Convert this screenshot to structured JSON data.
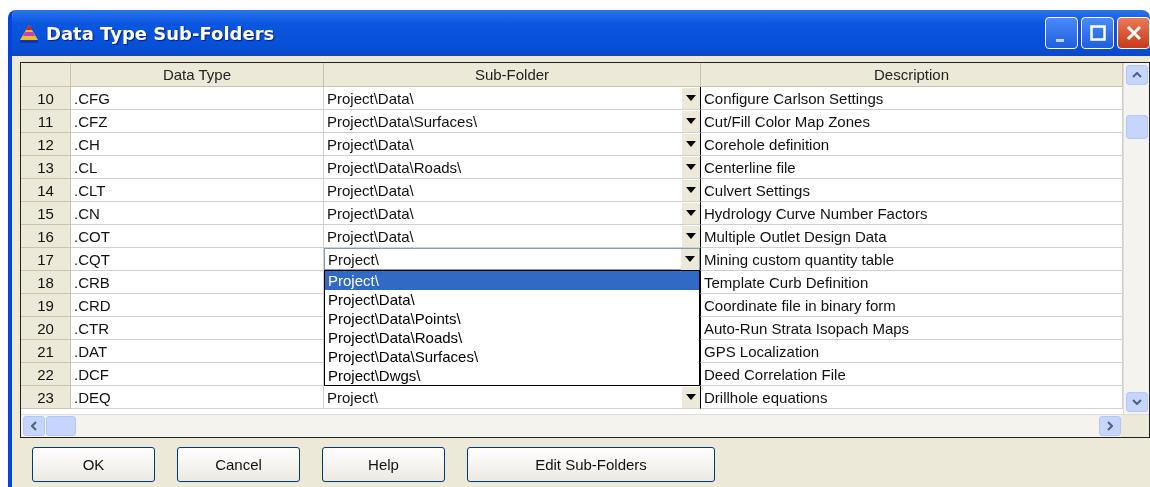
{
  "window": {
    "title": "Data Type Sub-Folders"
  },
  "table": {
    "columns": [
      "Data Type",
      "Sub-Folder",
      "Description"
    ],
    "rows": [
      {
        "number": "10",
        "data_type": ".CFG",
        "sub_folder": "Project\\Data\\",
        "description": "Configure Carlson Settings"
      },
      {
        "number": "11",
        "data_type": ".CFZ",
        "sub_folder": "Project\\Data\\Surfaces\\",
        "description": "Cut/Fill Color Map Zones"
      },
      {
        "number": "12",
        "data_type": ".CH",
        "sub_folder": "Project\\Data\\",
        "description": "Corehole definition"
      },
      {
        "number": "13",
        "data_type": ".CL",
        "sub_folder": "Project\\Data\\Roads\\",
        "description": "Centerline file"
      },
      {
        "number": "14",
        "data_type": ".CLT",
        "sub_folder": "Project\\Data\\",
        "description": "Culvert Settings"
      },
      {
        "number": "15",
        "data_type": ".CN",
        "sub_folder": "Project\\Data\\",
        "description": "Hydrology Curve Number Factors"
      },
      {
        "number": "16",
        "data_type": ".COT",
        "sub_folder": "Project\\Data\\",
        "description": "Multiple Outlet Design Data"
      },
      {
        "number": "17",
        "data_type": ".CQT",
        "sub_folder": "Project\\",
        "description": "Mining custom quantity table",
        "options": [
          {
            "label": "Project\\",
            "selected": true
          },
          {
            "label": "Project\\Data\\",
            "selected": false
          },
          {
            "label": "Project\\Data\\Points\\",
            "selected": false
          },
          {
            "label": "Project\\Data\\Roads\\",
            "selected": false
          },
          {
            "label": "Project\\Data\\Surfaces\\",
            "selected": false
          },
          {
            "label": "Project\\Dwgs\\",
            "selected": false
          }
        ]
      },
      {
        "number": "18",
        "data_type": ".CRB",
        "description": "Template Curb Definition"
      },
      {
        "number": "19",
        "data_type": ".CRD",
        "description": "Coordinate file in binary form"
      },
      {
        "number": "20",
        "data_type": ".CTR",
        "description": "Auto-Run Strata Isopach Maps"
      },
      {
        "number": "21",
        "data_type": ".DAT",
        "description": "GPS Localization"
      },
      {
        "number": "22",
        "data_type": ".DCF",
        "description": "Deed Correlation File"
      },
      {
        "number": "23",
        "data_type": ".DEQ",
        "sub_folder": "Project\\",
        "description": "Drillhole equations"
      }
    ]
  },
  "buttons": [
    "OK",
    "Cancel",
    "Help",
    "Edit Sub-Folders"
  ]
}
